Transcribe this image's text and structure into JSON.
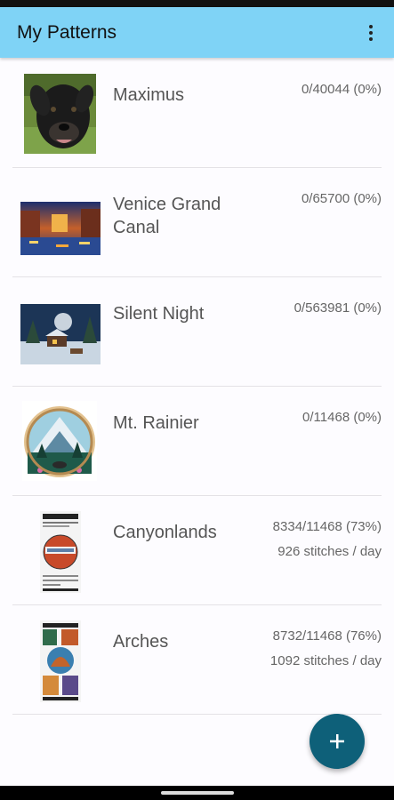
{
  "app": {
    "title": "My Patterns"
  },
  "patterns": [
    {
      "name": "Maximus",
      "progress": "0/40044 (0%)",
      "rate": ""
    },
    {
      "name": "Venice Grand Canal",
      "progress": "0/65700 (0%)",
      "rate": ""
    },
    {
      "name": "Silent Night",
      "progress": "0/563981 (0%)",
      "rate": ""
    },
    {
      "name": "Mt. Rainier",
      "progress": "0/11468 (0%)",
      "rate": ""
    },
    {
      "name": "Canyonlands",
      "progress": "8334/11468 (73%)",
      "rate": "926 stitches / day"
    },
    {
      "name": "Arches",
      "progress": "8732/11468 (76%)",
      "rate": "1092 stitches / day"
    }
  ],
  "fab": {
    "icon": "plus-icon"
  },
  "colors": {
    "appbar": "#7fd3f6",
    "fab": "#0e6079",
    "background": "#fdfcff"
  }
}
